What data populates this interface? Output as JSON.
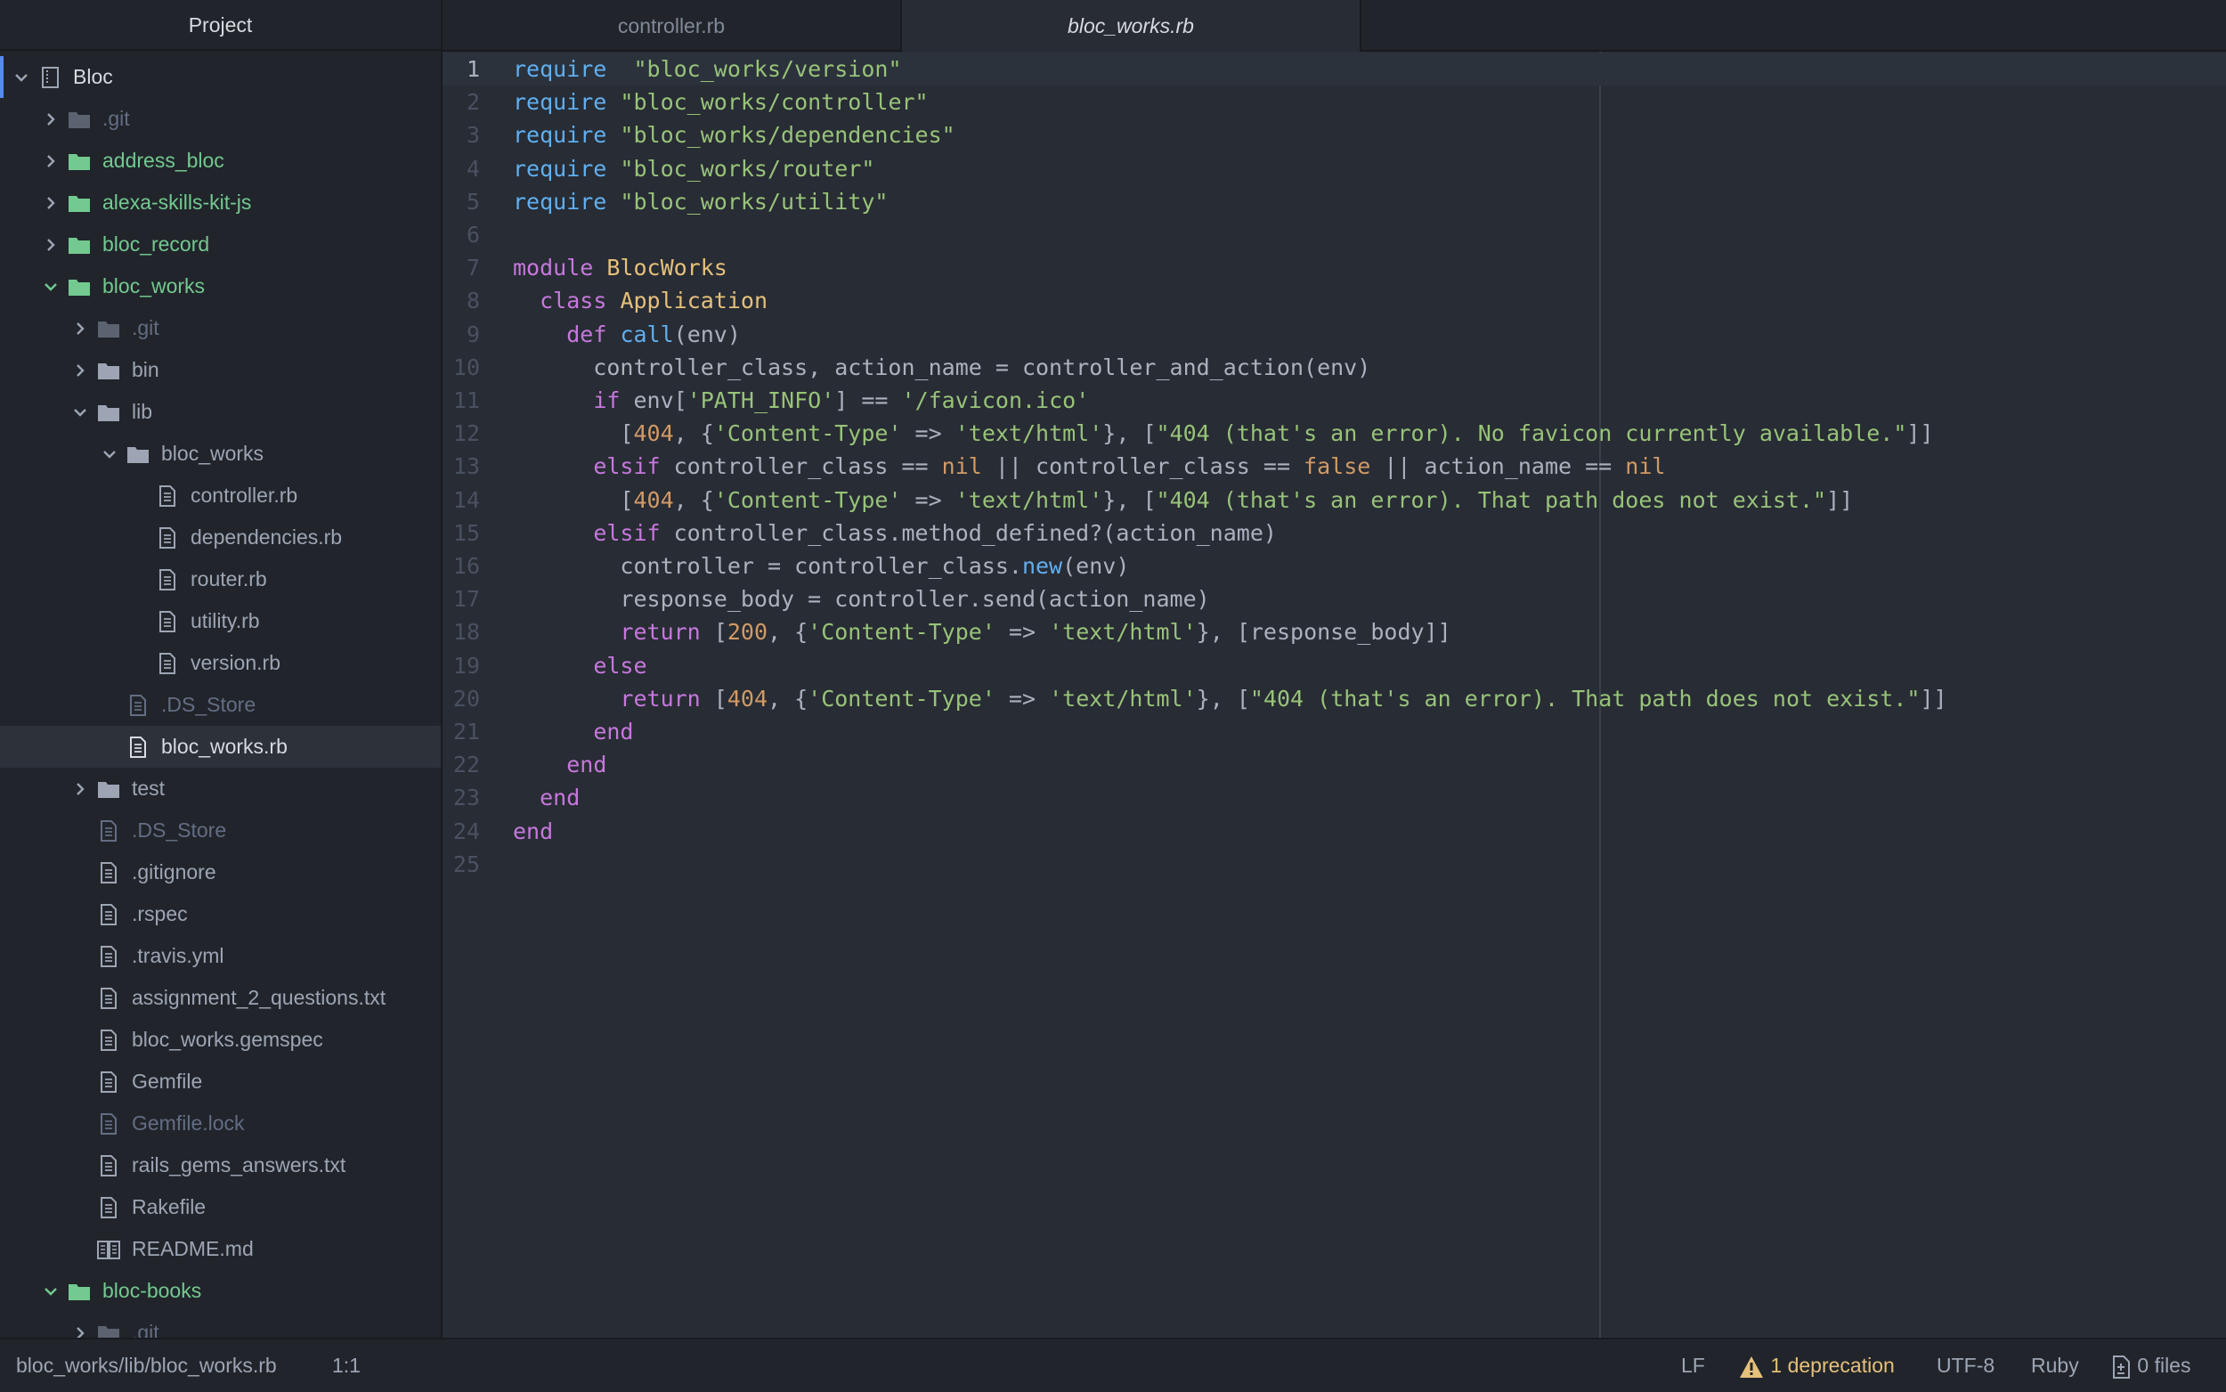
{
  "sidebar": {
    "title": "Project",
    "tree": [
      {
        "name": "Bloc",
        "type": "repo",
        "depth": 0,
        "state": "expanded",
        "tone": "bright",
        "root": true
      },
      {
        "name": ".git",
        "type": "folder",
        "depth": 1,
        "state": "collapsed",
        "tone": "dim"
      },
      {
        "name": "address_bloc",
        "type": "folder",
        "depth": 1,
        "state": "collapsed",
        "tone": "green"
      },
      {
        "name": "alexa-skills-kit-js",
        "type": "folder",
        "depth": 1,
        "state": "collapsed",
        "tone": "green"
      },
      {
        "name": "bloc_record",
        "type": "folder",
        "depth": 1,
        "state": "collapsed",
        "tone": "green"
      },
      {
        "name": "bloc_works",
        "type": "folder",
        "depth": 1,
        "state": "expanded",
        "tone": "green"
      },
      {
        "name": ".git",
        "type": "folder",
        "depth": 2,
        "state": "collapsed",
        "tone": "dim"
      },
      {
        "name": "bin",
        "type": "folder",
        "depth": 2,
        "state": "collapsed",
        "tone": "normal"
      },
      {
        "name": "lib",
        "type": "folder",
        "depth": 2,
        "state": "expanded",
        "tone": "normal"
      },
      {
        "name": "bloc_works",
        "type": "folder",
        "depth": 3,
        "state": "expanded",
        "tone": "normal"
      },
      {
        "name": "controller.rb",
        "type": "file",
        "depth": 4,
        "tone": "normal"
      },
      {
        "name": "dependencies.rb",
        "type": "file",
        "depth": 4,
        "tone": "normal"
      },
      {
        "name": "router.rb",
        "type": "file",
        "depth": 4,
        "tone": "normal"
      },
      {
        "name": "utility.rb",
        "type": "file",
        "depth": 4,
        "tone": "normal"
      },
      {
        "name": "version.rb",
        "type": "file",
        "depth": 4,
        "tone": "normal"
      },
      {
        "name": ".DS_Store",
        "type": "file",
        "depth": 3,
        "tone": "dim"
      },
      {
        "name": "bloc_works.rb",
        "type": "file",
        "depth": 3,
        "tone": "bright",
        "selected": true
      },
      {
        "name": "test",
        "type": "folder",
        "depth": 2,
        "state": "collapsed",
        "tone": "normal"
      },
      {
        "name": ".DS_Store",
        "type": "file",
        "depth": 2,
        "tone": "dim"
      },
      {
        "name": ".gitignore",
        "type": "file",
        "depth": 2,
        "tone": "normal"
      },
      {
        "name": ".rspec",
        "type": "file",
        "depth": 2,
        "tone": "normal"
      },
      {
        "name": ".travis.yml",
        "type": "file",
        "depth": 2,
        "tone": "normal"
      },
      {
        "name": "assignment_2_questions.txt",
        "type": "file",
        "depth": 2,
        "tone": "normal"
      },
      {
        "name": "bloc_works.gemspec",
        "type": "file",
        "depth": 2,
        "tone": "normal"
      },
      {
        "name": "Gemfile",
        "type": "file",
        "depth": 2,
        "tone": "normal"
      },
      {
        "name": "Gemfile.lock",
        "type": "file",
        "depth": 2,
        "tone": "dim"
      },
      {
        "name": "rails_gems_answers.txt",
        "type": "file",
        "depth": 2,
        "tone": "normal"
      },
      {
        "name": "Rakefile",
        "type": "file",
        "depth": 2,
        "tone": "normal"
      },
      {
        "name": "README.md",
        "type": "book",
        "depth": 2,
        "tone": "normal"
      },
      {
        "name": "bloc-books",
        "type": "folder",
        "depth": 1,
        "state": "expanded",
        "tone": "green"
      },
      {
        "name": ".git",
        "type": "folder",
        "depth": 2,
        "state": "collapsed",
        "tone": "dim"
      }
    ]
  },
  "tabs": [
    {
      "label": "controller.rb",
      "active": false
    },
    {
      "label": "bloc_works.rb",
      "active": true
    }
  ],
  "editor": {
    "current_line": 1,
    "lines": [
      [
        [
          "kw2",
          "require"
        ],
        [
          "",
          "  "
        ],
        [
          "str",
          "\"bloc_works/version\""
        ]
      ],
      [
        [
          "kw2",
          "require"
        ],
        [
          "",
          " "
        ],
        [
          "str",
          "\"bloc_works/controller\""
        ]
      ],
      [
        [
          "kw2",
          "require"
        ],
        [
          "",
          " "
        ],
        [
          "str",
          "\"bloc_works/dependencies\""
        ]
      ],
      [
        [
          "kw2",
          "require"
        ],
        [
          "",
          " "
        ],
        [
          "str",
          "\"bloc_works/router\""
        ]
      ],
      [
        [
          "kw2",
          "require"
        ],
        [
          "",
          " "
        ],
        [
          "str",
          "\"bloc_works/utility\""
        ]
      ],
      [],
      [
        [
          "kw",
          "module"
        ],
        [
          "",
          " "
        ],
        [
          "cls",
          "BlocWorks"
        ]
      ],
      [
        [
          "",
          "  "
        ],
        [
          "kw",
          "class"
        ],
        [
          "",
          " "
        ],
        [
          "cls",
          "Application"
        ]
      ],
      [
        [
          "",
          "    "
        ],
        [
          "kw",
          "def"
        ],
        [
          "",
          " "
        ],
        [
          "fn",
          "call"
        ],
        [
          "",
          "(env)"
        ]
      ],
      [
        [
          "",
          "      controller_class, action_name = controller_and_action(env)"
        ]
      ],
      [
        [
          "",
          "      "
        ],
        [
          "kw",
          "if"
        ],
        [
          "",
          " env["
        ],
        [
          "str",
          "'PATH_INFO'"
        ],
        [
          "",
          "] == "
        ],
        [
          "str",
          "'/favicon.ico'"
        ]
      ],
      [
        [
          "",
          "        ["
        ],
        [
          "num",
          "404"
        ],
        [
          "",
          ", {"
        ],
        [
          "str",
          "'Content-Type'"
        ],
        [
          "",
          " => "
        ],
        [
          "str",
          "'text/html'"
        ],
        [
          "",
          "}, ["
        ],
        [
          "str",
          "\"404 (that's an error). No favicon currently available.\""
        ],
        [
          "",
          "]]"
        ]
      ],
      [
        [
          "",
          "      "
        ],
        [
          "kw",
          "elsif"
        ],
        [
          "",
          " controller_class == "
        ],
        [
          "con",
          "nil"
        ],
        [
          "",
          " || controller_class == "
        ],
        [
          "con",
          "false"
        ],
        [
          "",
          " || action_name == "
        ],
        [
          "con",
          "nil"
        ]
      ],
      [
        [
          "",
          "        ["
        ],
        [
          "num",
          "404"
        ],
        [
          "",
          ", {"
        ],
        [
          "str",
          "'Content-Type'"
        ],
        [
          "",
          " => "
        ],
        [
          "str",
          "'text/html'"
        ],
        [
          "",
          "}, ["
        ],
        [
          "str",
          "\"404 (that's an error). That path does not exist.\""
        ],
        [
          "",
          "]]"
        ]
      ],
      [
        [
          "",
          "      "
        ],
        [
          "kw",
          "elsif"
        ],
        [
          "",
          " controller_class.method_defined?(action_name)"
        ]
      ],
      [
        [
          "",
          "        controller = controller_class."
        ],
        [
          "fn",
          "new"
        ],
        [
          "",
          "(env)"
        ]
      ],
      [
        [
          "",
          "        response_body = controller.send(action_name)"
        ]
      ],
      [
        [
          "",
          "        "
        ],
        [
          "kw",
          "return"
        ],
        [
          "",
          " ["
        ],
        [
          "num",
          "200"
        ],
        [
          "",
          ", {"
        ],
        [
          "str",
          "'Content-Type'"
        ],
        [
          "",
          " => "
        ],
        [
          "str",
          "'text/html'"
        ],
        [
          "",
          "}, [response_body]]"
        ]
      ],
      [
        [
          "",
          "      "
        ],
        [
          "kw",
          "else"
        ]
      ],
      [
        [
          "",
          "        "
        ],
        [
          "kw",
          "return"
        ],
        [
          "",
          " ["
        ],
        [
          "num",
          "404"
        ],
        [
          "",
          ", {"
        ],
        [
          "str",
          "'Content-Type'"
        ],
        [
          "",
          " => "
        ],
        [
          "str",
          "'text/html'"
        ],
        [
          "",
          "}, ["
        ],
        [
          "str",
          "\"404 (that's an error). That path does not exist.\""
        ],
        [
          "",
          "]]"
        ]
      ],
      [
        [
          "",
          "      "
        ],
        [
          "kw",
          "end"
        ]
      ],
      [
        [
          "",
          "    "
        ],
        [
          "kw",
          "end"
        ]
      ],
      [
        [
          "",
          "  "
        ],
        [
          "kw",
          "end"
        ]
      ],
      [
        [
          "kw",
          "end"
        ]
      ],
      []
    ]
  },
  "statusbar": {
    "path": "bloc_works/lib/bloc_works.rb",
    "cursor": "1:1",
    "line_ending": "LF",
    "deprecation": "1 deprecation",
    "encoding": "UTF-8",
    "grammar": "Ruby",
    "git_files": "0 files"
  },
  "colors": {
    "accent": "#568af2",
    "green": "#73c990",
    "warning": "#e5c07b"
  }
}
